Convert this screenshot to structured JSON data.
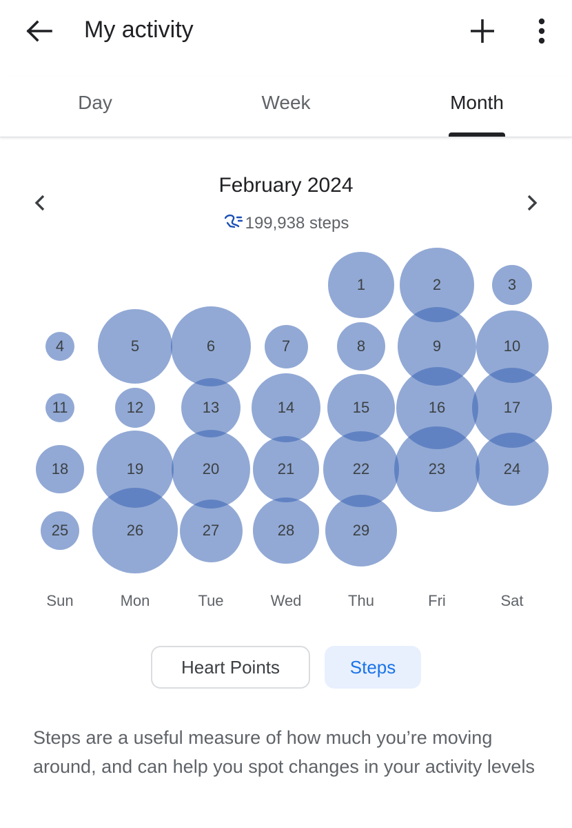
{
  "header": {
    "title": "My activity",
    "back_icon": "arrow-back-icon",
    "add_icon": "plus-icon",
    "more_icon": "more-vert-icon"
  },
  "tabs": [
    {
      "label": "Day",
      "active": false
    },
    {
      "label": "Week",
      "active": false
    },
    {
      "label": "Month",
      "active": true
    }
  ],
  "month": {
    "title": "February 2024",
    "steps_total": "199,938 steps",
    "steps_icon": "steps-icon",
    "prev_icon": "chevron-left-icon",
    "next_icon": "chevron-right-icon"
  },
  "calendar": {
    "weekdays": [
      "Sun",
      "Mon",
      "Tue",
      "Wed",
      "Thu",
      "Fri",
      "Sat"
    ],
    "bubble_color": "#3962b2",
    "days": [
      {
        "day": "1",
        "level": 0.68
      },
      {
        "day": "2",
        "level": 0.77
      },
      {
        "day": "3",
        "level": 0.42
      },
      {
        "day": "4",
        "level": 0.3
      },
      {
        "day": "5",
        "level": 0.77
      },
      {
        "day": "6",
        "level": 0.83
      },
      {
        "day": "7",
        "level": 0.45
      },
      {
        "day": "8",
        "level": 0.5
      },
      {
        "day": "9",
        "level": 0.82
      },
      {
        "day": "10",
        "level": 0.75
      },
      {
        "day": "11",
        "level": 0.3
      },
      {
        "day": "12",
        "level": 0.42
      },
      {
        "day": "13",
        "level": 0.62
      },
      {
        "day": "14",
        "level": 0.72
      },
      {
        "day": "15",
        "level": 0.7
      },
      {
        "day": "16",
        "level": 0.85
      },
      {
        "day": "17",
        "level": 0.83
      },
      {
        "day": "18",
        "level": 0.5
      },
      {
        "day": "19",
        "level": 0.8
      },
      {
        "day": "20",
        "level": 0.82
      },
      {
        "day": "21",
        "level": 0.68
      },
      {
        "day": "22",
        "level": 0.78
      },
      {
        "day": "23",
        "level": 0.88
      },
      {
        "day": "24",
        "level": 0.76
      },
      {
        "day": "25",
        "level": 0.4
      },
      {
        "day": "26",
        "level": 0.88
      },
      {
        "day": "27",
        "level": 0.65
      },
      {
        "day": "28",
        "level": 0.68
      },
      {
        "day": "29",
        "level": 0.74
      }
    ]
  },
  "chips": {
    "heart_points": "Heart Points",
    "steps": "Steps",
    "selected": "Steps"
  },
  "description": "Steps are a useful measure of how much you’re moving around, and can help you spot changes in your activity levels"
}
